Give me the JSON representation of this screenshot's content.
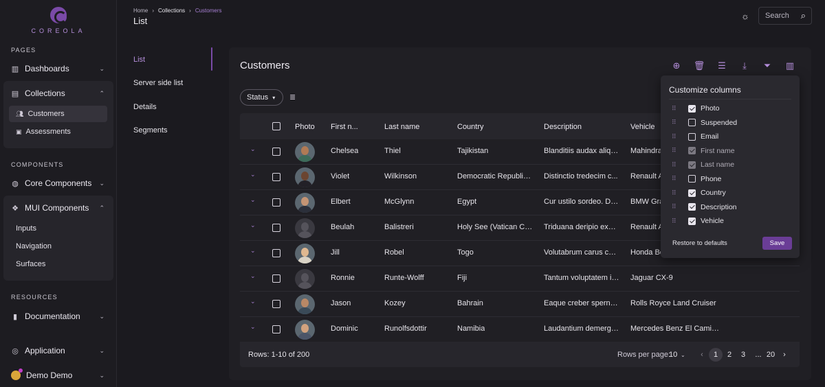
{
  "brand": {
    "name": "COREOLA"
  },
  "sidebar": {
    "sections": {
      "pages": "PAGES",
      "components": "COMPONENTS",
      "resources": "RESOURCES"
    },
    "dashboards": "Dashboards",
    "collections": "Collections",
    "customers": "Customers",
    "assessments": "Assessments",
    "core_components": "Core Components",
    "mui_components": "MUI Components",
    "inputs": "Inputs",
    "navigation": "Navigation",
    "surfaces": "Surfaces",
    "documentation": "Documentation",
    "application": "Application",
    "user": "Demo Demo"
  },
  "header": {
    "breadcrumb": [
      "Home",
      "Collections",
      "Customers"
    ],
    "title": "List",
    "search_placeholder": "Search"
  },
  "subnav": [
    "List",
    "Server side list",
    "Details",
    "Segments"
  ],
  "panel": {
    "title": "Customers",
    "status_filter": "Status"
  },
  "table": {
    "columns": [
      "Photo",
      "First n...",
      "Last name",
      "Country",
      "Description",
      "Vehicle"
    ],
    "rows": [
      {
        "first": "Chelsea",
        "last": "Thiel",
        "country": "Tajikistan",
        "description": "Blanditiis audax aliqu...",
        "vehicle": "Mahindra",
        "skin": "#b07a55",
        "shirt": "#3d6b5a"
      },
      {
        "first": "Violet",
        "last": "Wilkinson",
        "country": "Democratic Republic ...",
        "description": "Distinctio tredecim c...",
        "vehicle": "Renault Ac",
        "skin": "#6b4530",
        "shirt": "#222027"
      },
      {
        "first": "Elbert",
        "last": "McGlynn",
        "country": "Egypt",
        "description": "Cur ustilo sordeo. De...",
        "vehicle": "BMW Gran",
        "skin": "#c49474",
        "shirt": "#2b2f3a"
      },
      {
        "first": "Beulah",
        "last": "Balistreri",
        "country": "Holy See (Vatican Cit...",
        "description": "Triduana deripio exer...",
        "vehicle": "Renault Ac",
        "skin": null,
        "shirt": null
      },
      {
        "first": "Jill",
        "last": "Robel",
        "country": "Togo",
        "description": "Volutabrum carus car...",
        "vehicle": "Honda Be",
        "skin": "#e0b890",
        "shirt": "#d9d2c5"
      },
      {
        "first": "Ronnie",
        "last": "Runte-Wolff",
        "country": "Fiji",
        "description": "Tantum voluptatem ip...",
        "vehicle": "Jaguar CX-9",
        "skin": null,
        "shirt": null
      },
      {
        "first": "Jason",
        "last": "Kozey",
        "country": "Bahrain",
        "description": "Eaque creber sperno ...",
        "vehicle": "Rolls Royce Land Cruiser",
        "skin": "#b88866",
        "shirt": "#3a4a58"
      },
      {
        "first": "Dominic",
        "last": "Runolfsdottir",
        "country": "Namibia",
        "description": "Laudantium demergo...",
        "vehicle": "Mercedes Benz El Camino",
        "skin": "#d2a27e",
        "shirt": "#4c5568"
      }
    ]
  },
  "footer": {
    "rows_info": "Rows: 1-10 of 200",
    "rows_per_page_label": "Rows per page:",
    "rows_per_page": "10",
    "pages": [
      "1",
      "2",
      "3",
      "...",
      "20"
    ]
  },
  "customize": {
    "title": "Customize columns",
    "columns": [
      {
        "label": "Photo",
        "state": "checked"
      },
      {
        "label": "Suspended",
        "state": "unchecked"
      },
      {
        "label": "Email",
        "state": "unchecked"
      },
      {
        "label": "First name",
        "state": "disabled"
      },
      {
        "label": "Last name",
        "state": "disabled"
      },
      {
        "label": "Phone",
        "state": "unchecked"
      },
      {
        "label": "Country",
        "state": "checked"
      },
      {
        "label": "Description",
        "state": "checked"
      },
      {
        "label": "Vehicle",
        "state": "checked"
      }
    ],
    "restore": "Restore to defaults",
    "save": "Save"
  },
  "colors": {
    "accent": "#7a4aa8",
    "accent_text": "#b68fdc",
    "background": "#1b1a1f"
  }
}
